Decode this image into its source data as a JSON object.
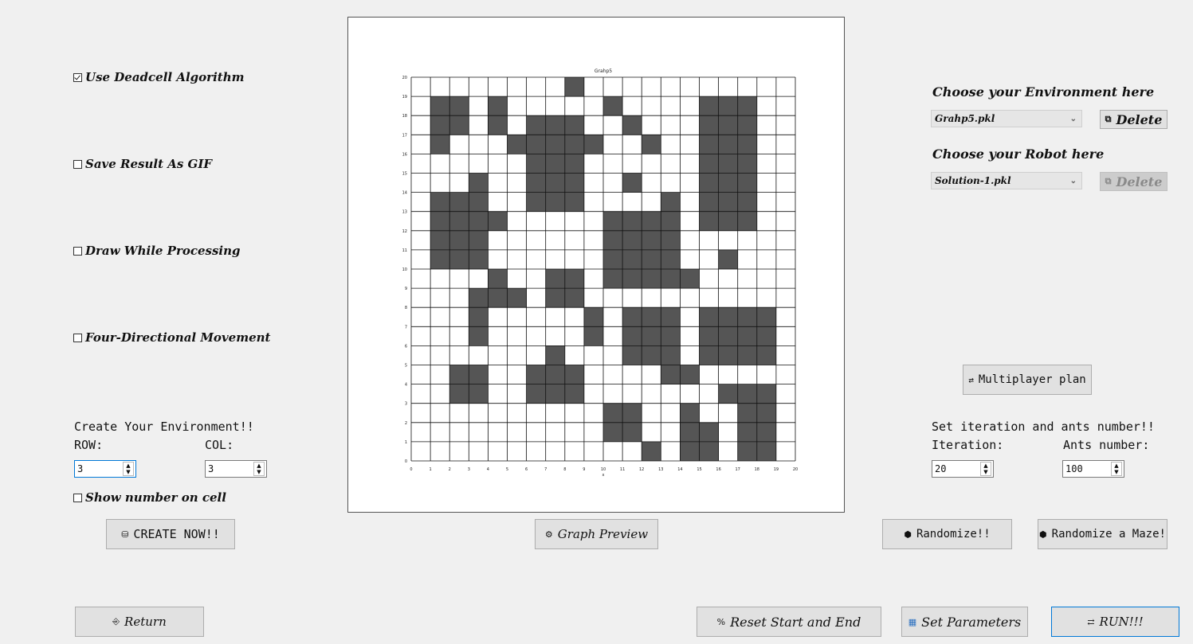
{
  "options": {
    "deadcell": {
      "label": "Use Deadcell Algorithm",
      "checked": true
    },
    "gif": {
      "label": "Save Result As GIF",
      "checked": false
    },
    "draw": {
      "label": "Draw While Processing",
      "checked": false
    },
    "four_dir": {
      "label": "Four-Directional Movement",
      "checked": false
    },
    "show_number": {
      "label": "Show number on cell",
      "checked": false
    }
  },
  "create": {
    "title": "Create Your Environment!!",
    "row_label": "ROW:",
    "col_label": "COL:",
    "row_value": "3",
    "col_value": "3",
    "button": "CREATE NOW!!"
  },
  "graph": {
    "title": "Grahp5",
    "xlabel": "x",
    "rows": 20,
    "cols": 20,
    "obstacles": [
      "19,8",
      "18,1",
      "18,2",
      "18,4",
      "18,10",
      "18,15",
      "18,16",
      "18,17",
      "17,1",
      "17,2",
      "17,4",
      "17,6",
      "17,7",
      "17,8",
      "17,11",
      "17,15",
      "17,16",
      "17,17",
      "16,1",
      "16,5",
      "16,6",
      "16,7",
      "16,8",
      "16,9",
      "16,12",
      "16,15",
      "16,16",
      "16,17",
      "15,6",
      "15,7",
      "15,8",
      "15,15",
      "15,16",
      "15,17",
      "14,3",
      "14,6",
      "14,7",
      "14,8",
      "14,11",
      "14,15",
      "14,16",
      "14,17",
      "13,1",
      "13,2",
      "13,3",
      "13,6",
      "13,7",
      "13,8",
      "13,13",
      "13,15",
      "13,16",
      "13,17",
      "12,1",
      "12,2",
      "12,3",
      "12,4",
      "12,10",
      "12,11",
      "12,12",
      "12,13",
      "12,15",
      "12,16",
      "12,17",
      "11,1",
      "11,2",
      "11,3",
      "11,10",
      "11,11",
      "11,12",
      "11,13",
      "10,1",
      "10,2",
      "10,3",
      "10,10",
      "10,11",
      "10,12",
      "10,13",
      "10,16",
      "9,4",
      "9,7",
      "9,8",
      "9,10",
      "9,11",
      "9,12",
      "9,13",
      "9,14",
      "8,3",
      "8,4",
      "8,5",
      "8,7",
      "8,8",
      "7,3",
      "7,9",
      "7,11",
      "7,12",
      "7,13",
      "7,15",
      "7,16",
      "7,17",
      "7,18",
      "6,3",
      "6,9",
      "6,11",
      "6,12",
      "6,13",
      "6,15",
      "6,16",
      "6,17",
      "6,18",
      "5,7",
      "5,11",
      "5,12",
      "5,13",
      "5,15",
      "5,16",
      "5,17",
      "5,18",
      "4,2",
      "4,3",
      "4,6",
      "4,7",
      "4,8",
      "4,13",
      "4,14",
      "3,2",
      "3,3",
      "3,6",
      "3,7",
      "3,8",
      "3,16",
      "3,17",
      "3,18",
      "2,10",
      "2,11",
      "2,14",
      "2,17",
      "2,18",
      "1,10",
      "1,11",
      "1,14",
      "1,15",
      "1,17",
      "1,18",
      "0,12",
      "0,14",
      "0,15",
      "0,17",
      "0,18",
      "0,14"
    ],
    "preview_button": "Graph Preview"
  },
  "environment": {
    "env_label": "Choose your Environment here",
    "env_value": "Grahp5.pkl",
    "env_delete": "Delete",
    "robot_label": "Choose your Robot here",
    "robot_value": "Solution-1.pkl",
    "robot_delete": "Delete"
  },
  "multiplayer": "Multiplayer plan",
  "params": {
    "title": "Set iteration and ants number!!",
    "iteration_label": "Iteration:",
    "ants_label": "Ants number:",
    "iteration_value": "20",
    "ants_value": "100"
  },
  "randomize": "Randomize!!",
  "randomize_maze": "Randomize a Maze!",
  "bottom": {
    "return": "Return",
    "reset": "Reset Start and End",
    "set_params": "Set Parameters",
    "run": "RUN!!!"
  },
  "icons": {
    "create": "folder-icon",
    "preview": "gear-icon",
    "delete": "trash-icon",
    "multi": "swap-icon",
    "randomize": "hexagon-icon",
    "return": "exit-icon",
    "reset": "percent-icon",
    "params": "calendar-icon",
    "run": "swap-icon"
  }
}
